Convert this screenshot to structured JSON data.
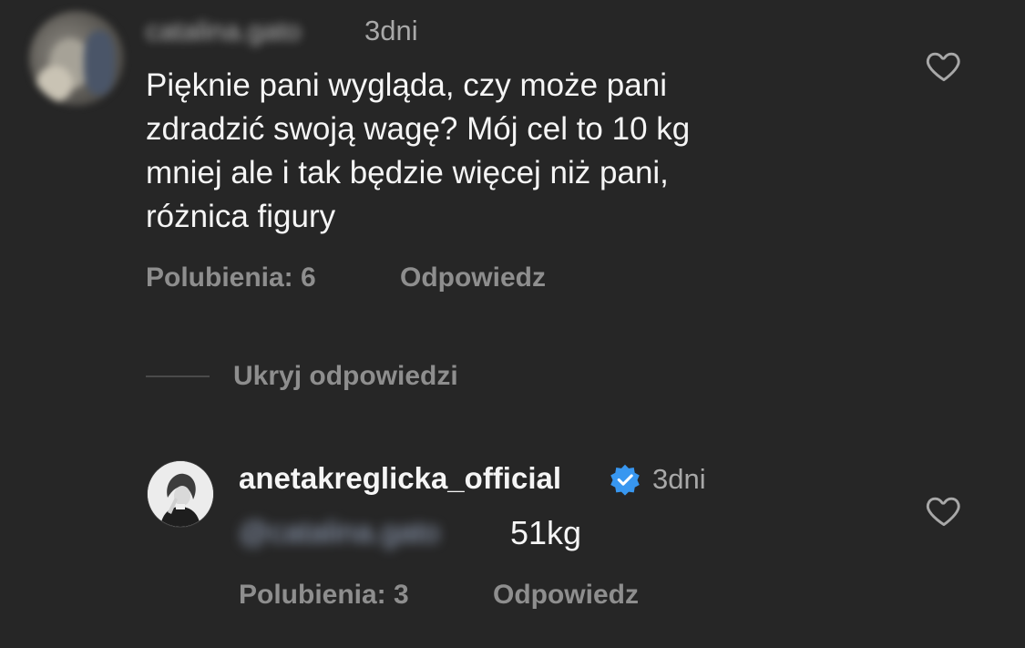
{
  "comment": {
    "username": "catalina.gato",
    "time": "3dni",
    "text_lines": [
      "Pięknie pani wygląda, czy może pani",
      "zdradzić swoją wagę? Mój cel to 10 kg",
      "mniej ale i tak będzie więcej niż pani,",
      "różnica figury"
    ],
    "likes_label": "Polubienia: 6",
    "reply_label": "Odpowiedz",
    "like_icon": "heart-outline-icon"
  },
  "hide_replies_label": "Ukryj odpowiedzi",
  "reply": {
    "username": "anetakreglicka_official",
    "verified_icon": "verified-badge-icon",
    "verified_color": "#3897f0",
    "time": "3dni",
    "mention": "@catalina.gato",
    "text": "51kg",
    "likes_label": "Polubienia: 3",
    "reply_label": "Odpowiedz",
    "like_icon": "heart-outline-icon"
  },
  "colors": {
    "background": "#262626",
    "primary_text": "#f5f5f5",
    "secondary_text": "#8e8e8e"
  }
}
